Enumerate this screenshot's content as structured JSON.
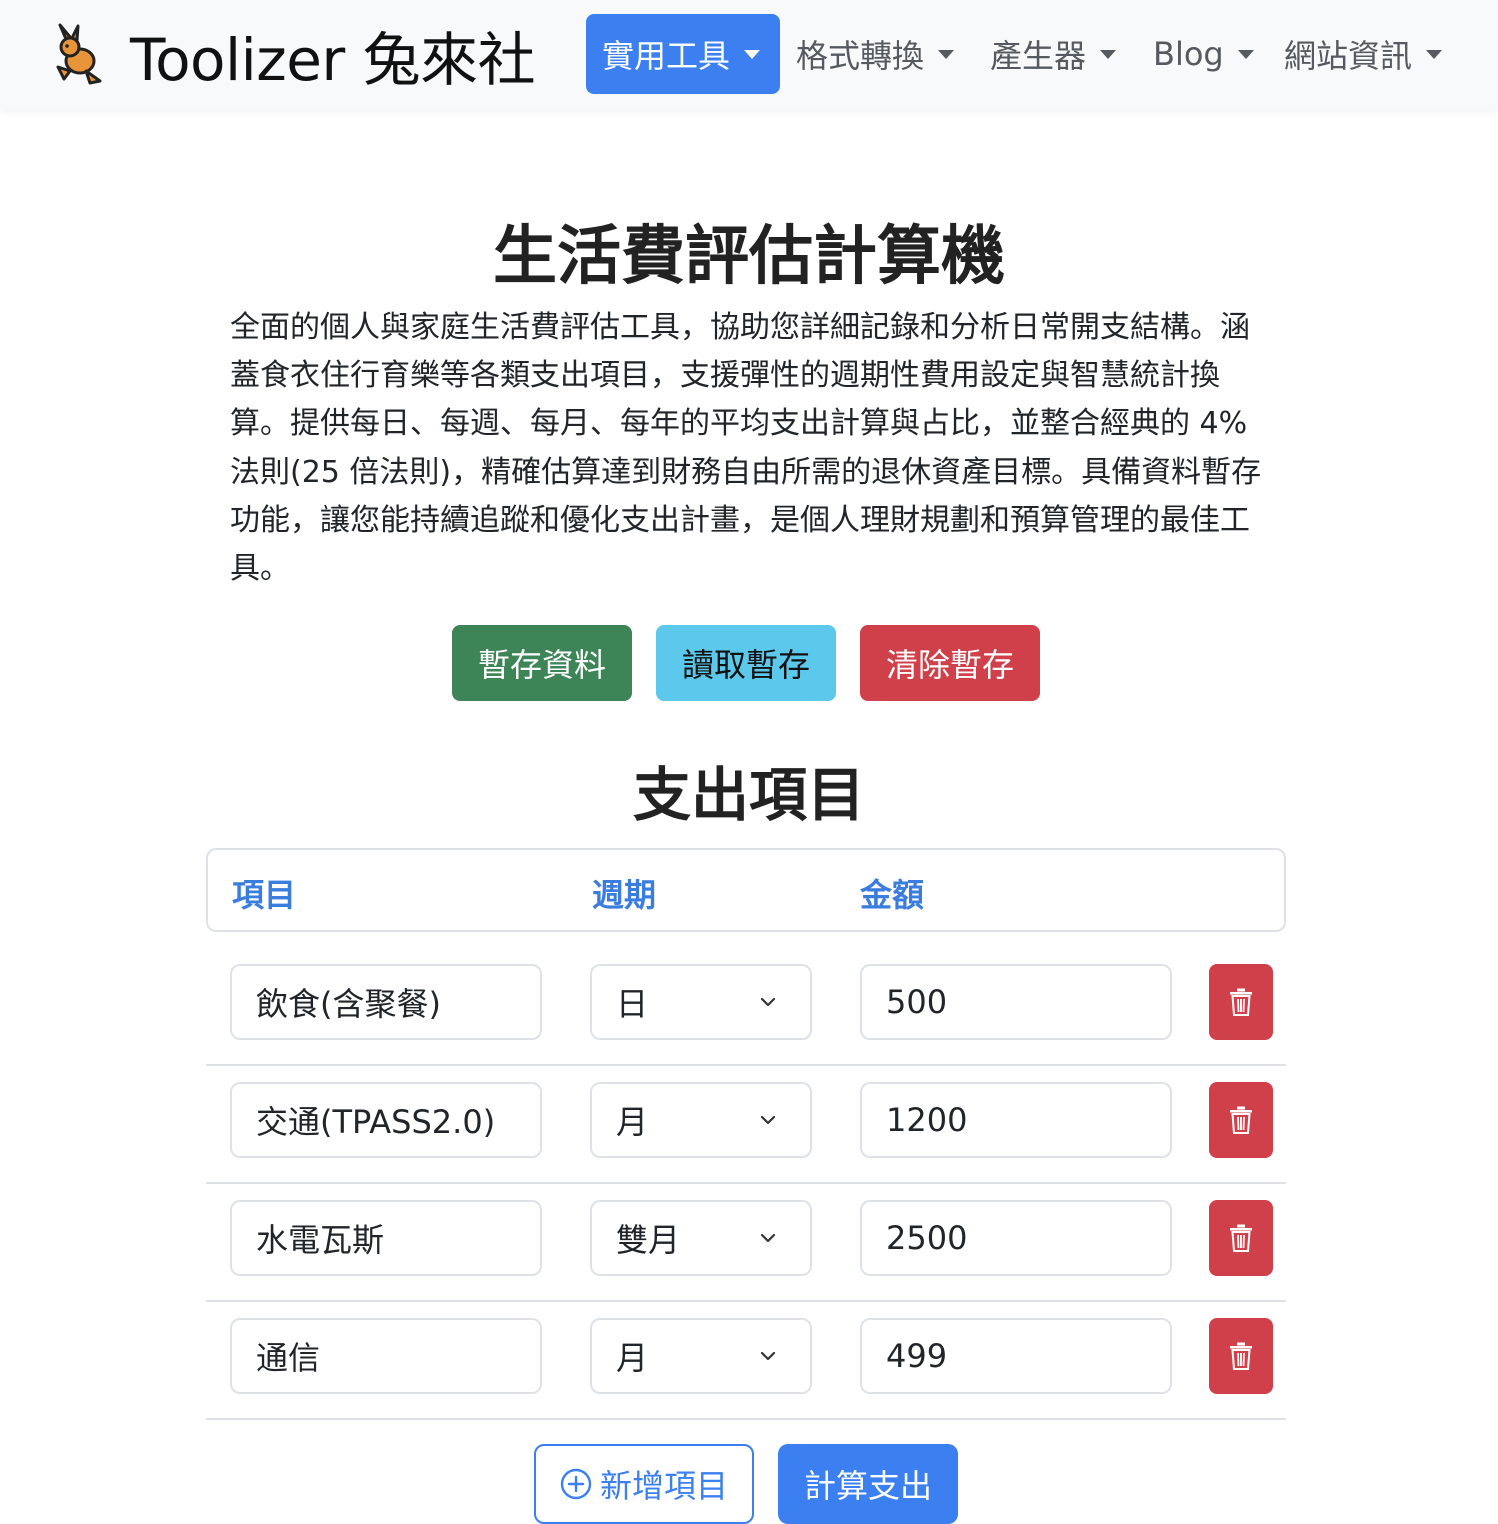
{
  "brand": {
    "name": "Toolizer 兔來社"
  },
  "nav": {
    "items": [
      {
        "label": "實用工具"
      },
      {
        "label": "格式轉換"
      },
      {
        "label": "產生器"
      },
      {
        "label": "Blog"
      },
      {
        "label": "網站資訊"
      }
    ]
  },
  "main": {
    "title": "生活費評估計算機",
    "intro": "全面的個人與家庭生活費評估工具，協助您詳細記錄和分析日常開支結構。涵蓋食衣住行育樂等各類支出項目，支援彈性的週期性費用設定與智慧統計換算。提供每日、每週、每月、每年的平均支出計算與占比，並整合經典的 4% 法則(25 倍法則)，精確估算達到財務自由所需的退休資產目標。具備資料暫存功能，讓您能持續追蹤和優化支出計畫，是個人理財規劃和預算管理的最佳工具。",
    "actions": {
      "save": "暫存資料",
      "load": "讀取暫存",
      "clear": "清除暫存"
    },
    "section_title": "支出項目",
    "table": {
      "headers": [
        "項目",
        "週期",
        "金額"
      ],
      "rows": [
        {
          "name": "飲食(含聚餐)",
          "period": "日",
          "amount": "500"
        },
        {
          "name": "交通(TPASS2.0)",
          "period": "月",
          "amount": "1200"
        },
        {
          "name": "水電瓦斯",
          "period": "雙月",
          "amount": "2500"
        },
        {
          "name": "通信",
          "period": "月",
          "amount": "499"
        }
      ]
    },
    "bottom": {
      "add": "新增項目",
      "calc": "計算支出"
    }
  },
  "colors": {
    "primary": "#3b7ff0",
    "success": "#3d8557",
    "info": "#5bc8ec",
    "danger": "#d0404a"
  }
}
